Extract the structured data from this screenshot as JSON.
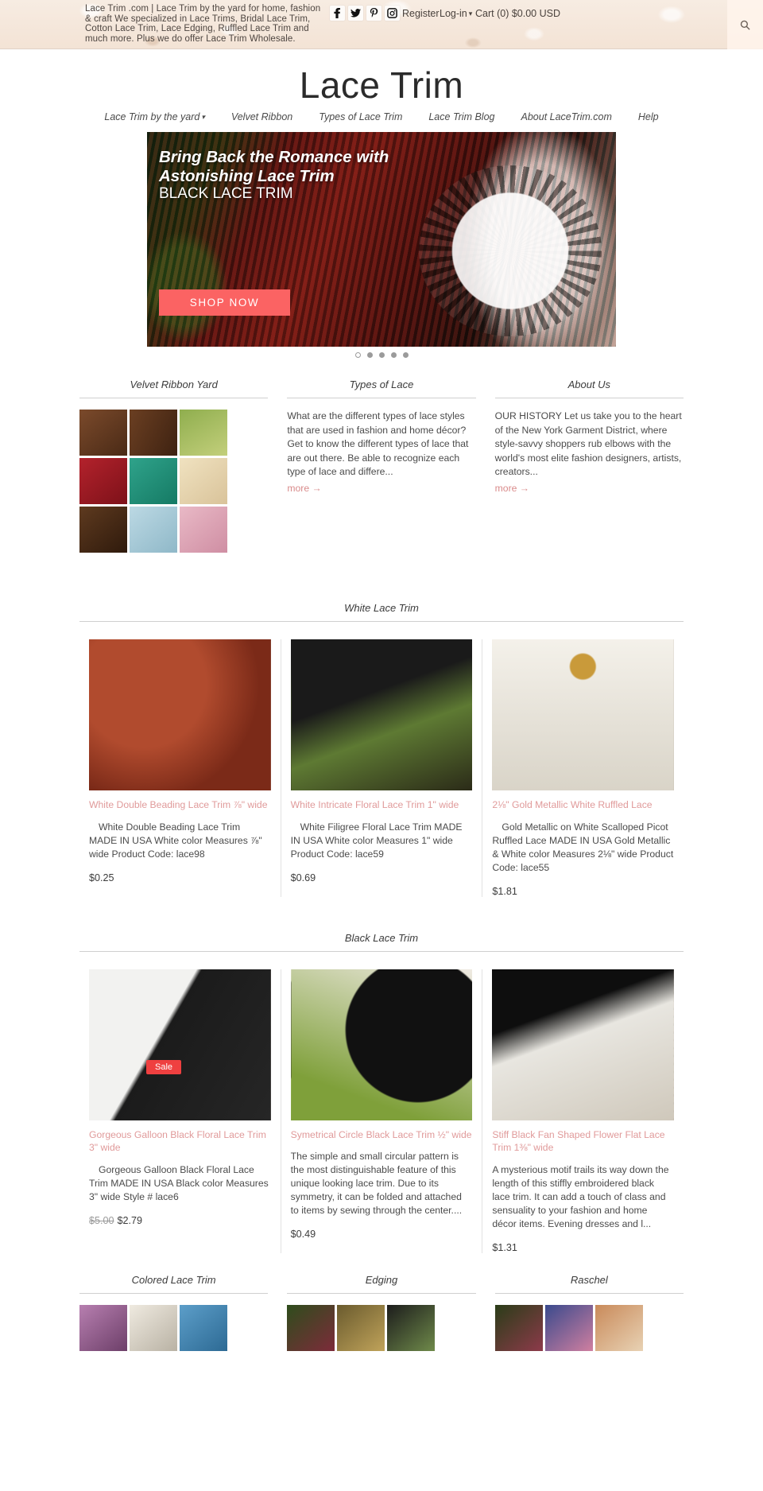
{
  "topbar": {
    "tagline": "Lace Trim .com | Lace Trim by the yard for home, fashion & craft We specialized in Lace Trims, Bridal Lace Trim, Cotton Lace Trim, Lace Edging, Ruffled Lace Trim and much more. Plus we do offer Lace Trim Wholesale.",
    "social": [
      {
        "name": "facebook-icon",
        "label": "f"
      },
      {
        "name": "twitter-icon",
        "label": "t"
      },
      {
        "name": "pinterest-icon",
        "label": "P"
      },
      {
        "name": "instagram-icon",
        "label": "ig"
      }
    ],
    "register": "Register",
    "login": "Log-in",
    "cart": "Cart (0) $0.00 USD",
    "search_icon": "search-icon"
  },
  "header": {
    "logo": "Lace Trim",
    "nav": [
      "Lace Trim by the yard",
      "Velvet Ribbon",
      "Types of Lace Trim",
      "Lace Trim Blog",
      "About LaceTrim.com",
      "Help"
    ]
  },
  "hero": {
    "headline": "Bring Back the Romance with Astonishing Lace Trim",
    "subhead": "BLACK LACE TRIM",
    "button": "SHOP NOW",
    "dots": 5,
    "active_dot": 0,
    "button_color": "#fb6363"
  },
  "features": [
    {
      "title": "Velvet Ribbon Yard",
      "type": "thumbs",
      "thumbs": [
        "t-v1",
        "t-v2",
        "t-v3",
        "t-v4",
        "t-v5",
        "t-v6",
        "t-v7",
        "t-v8",
        "t-v9"
      ]
    },
    {
      "title": "Types of Lace",
      "type": "text",
      "body": "What are the different types of lace styles that are used in fashion and home décor?  Get to know the different types of lace that are out there.  Be able to recognize each type of lace and differe...",
      "more": "more →"
    },
    {
      "title": "About Us",
      "type": "text",
      "body": "   OUR HISTORY  Let us take you to the heart of the New York Garment District, where style-savvy shoppers rub elbows with the world's most elite fashion designers, artists, creators...",
      "more": "more →"
    }
  ],
  "white_section": {
    "title": "White Lace Trim",
    "products": [
      {
        "title": "White Double Beading Lace Trim ⅞\" wide",
        "desc": "White Double Beading Lace Trim MADE IN USA White color Measures ⅞\" wide Product Code: lace98",
        "price": "$0.25",
        "image": "i-box"
      },
      {
        "title": "White Intricate Floral Lace Trim 1\" wide",
        "desc": "White Filigree Floral Lace Trim MADE IN USA White color Measures 1\" wide Product Code: lace59",
        "price": "$0.69",
        "image": "i-floral"
      },
      {
        "title": "2⅛\" Gold Metallic White Ruffled Lace",
        "desc": "Gold Metallic on White Scalloped Picot Ruffled Lace MADE IN USA Gold Metallic & White color Measures 2⅛\" wide Product Code: lace55",
        "price": "$1.81",
        "image": "i-gold"
      }
    ]
  },
  "black_section": {
    "title": "Black Lace Trim",
    "sale_badge": "Sale",
    "products": [
      {
        "title": "Gorgeous Galloon Black Floral Lace Trim 3\" wide",
        "desc": "Gorgeous Galloon Black Floral Lace Trim MADE IN USA Black color Measures 3\" wide Style # lace6",
        "old_price": "$5.00",
        "price": "$2.79",
        "image": "i-black1",
        "sale": true
      },
      {
        "title": "Symetrical Circle Black Lace Trim ½\" wide",
        "desc": "The simple and small circular pattern is the most distinguishable feature of this unique looking lace trim. Due to its symmetry, it can be folded and attached to items by sewing through the center....",
        "price": "$0.49",
        "image": "i-black2",
        "sale": false
      },
      {
        "title": "Stiff Black Fan Shaped Flower Flat Lace Trim 1⅜\" wide",
        "desc": "A mysterious motif trails its way down the length of this stiffly embroidered black lace trim. It can add a touch of class and sensuality to your fashion and home décor items. Evening dresses and l...",
        "price": "$1.31",
        "image": "i-black3",
        "sale": false
      }
    ]
  },
  "bottom_features": [
    {
      "title": "Colored Lace Trim",
      "thumbs": [
        "t-c1",
        "t-c2",
        "t-c3"
      ]
    },
    {
      "title": "Edging",
      "thumbs": [
        "t-c4",
        "t-c5",
        "t-c6"
      ]
    },
    {
      "title": "Raschel",
      "thumbs": [
        "t-c7",
        "t-c8",
        "t-c9"
      ]
    }
  ]
}
